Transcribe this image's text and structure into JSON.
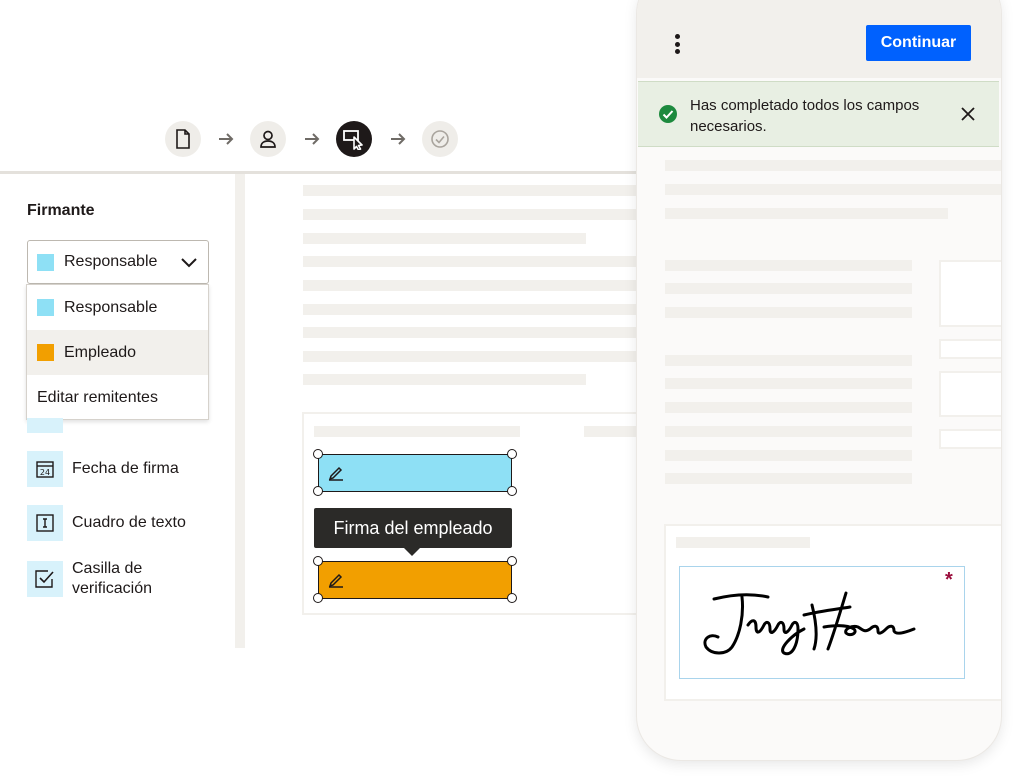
{
  "stepper": {
    "steps": [
      {
        "name": "document",
        "icon": "document-icon"
      },
      {
        "name": "recipient",
        "icon": "person-icon"
      },
      {
        "name": "fields",
        "icon": "field-cursor-icon",
        "active": true
      },
      {
        "name": "review",
        "icon": "check-circle-icon"
      }
    ]
  },
  "sidebar": {
    "signer_label": "Firmante",
    "selected": {
      "label": "Responsable",
      "color": "#8ee0f5"
    },
    "options": [
      {
        "label": "Responsable",
        "color": "#8ee0f5"
      },
      {
        "label": "Empleado",
        "color": "#f29f00"
      }
    ],
    "edit_senders": "Editar remitentes",
    "tools": [
      {
        "label": "Fecha de firma",
        "icon": "calendar-icon"
      },
      {
        "label": "Cuadro de texto",
        "icon": "text-box-icon"
      },
      {
        "label": "Casilla de verificación",
        "icon": "checkbox-icon"
      }
    ]
  },
  "document": {
    "tooltip": "Firma del empleado",
    "field_colors": {
      "manager": "#8ee0f5",
      "employee": "#f29f00"
    }
  },
  "phone": {
    "continue_label": "Continuar",
    "banner_text": "Has completado todos los campos necesarios.",
    "required_marker": "*",
    "accent": "#0061fe"
  }
}
